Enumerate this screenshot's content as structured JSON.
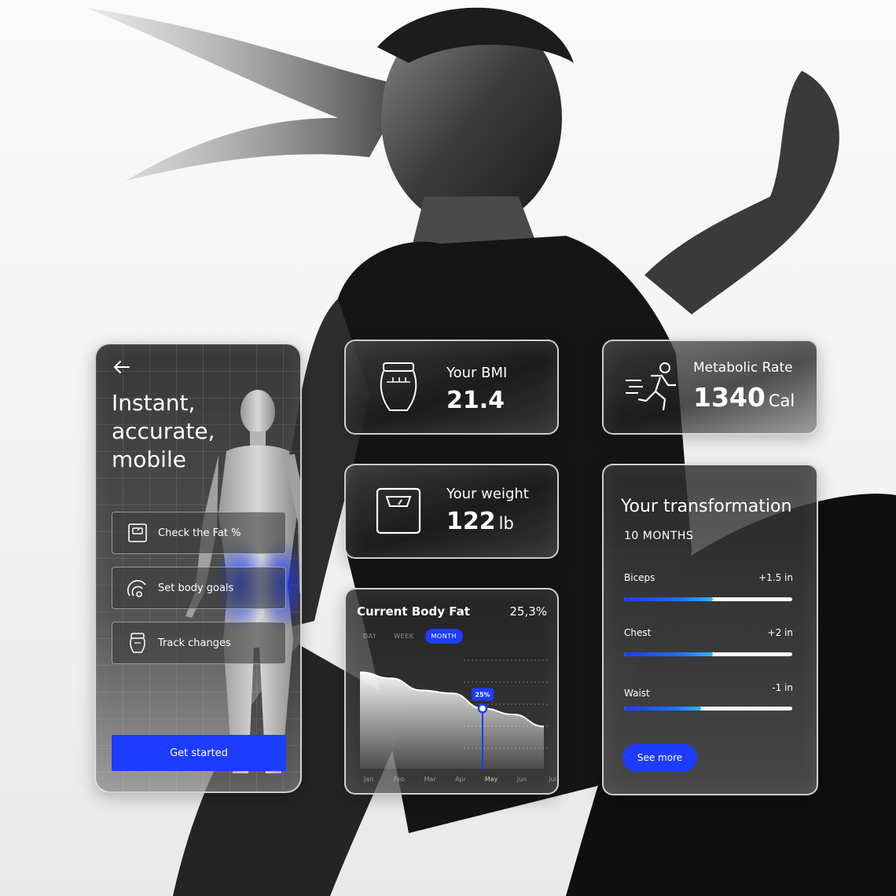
{
  "phone": {
    "back_icon": "arrow-left-icon",
    "title_lines": [
      "Instant,",
      "accurate,",
      "mobile"
    ],
    "options": [
      {
        "label": "Check the Fat %",
        "icon": "scale-icon"
      },
      {
        "label": "Set body goals",
        "icon": "goal-gauge-icon"
      },
      {
        "label": "Track changes",
        "icon": "body-measure-icon"
      }
    ],
    "cta_label": "Get started"
  },
  "bmi": {
    "label": "Your BMI",
    "value": "21.4",
    "icon": "waist-measure-icon"
  },
  "metabolic": {
    "label": "Metabolic Rate",
    "value": "1340",
    "unit": "Cal",
    "icon": "running-person-icon"
  },
  "weight": {
    "label": "Your weight",
    "value": "122",
    "unit": "lb",
    "icon": "weight-scale-icon"
  },
  "body_fat": {
    "title": "Current Body Fat",
    "value": "25,3%",
    "tabs": [
      {
        "label": "DAY",
        "active": false
      },
      {
        "label": "WEEK",
        "active": false
      },
      {
        "label": "MONTH",
        "active": true
      }
    ],
    "marker_label": "25%"
  },
  "chart_data": {
    "type": "area",
    "x": [
      "Jan",
      "Feb",
      "Mar",
      "Apr",
      "May",
      "Jun",
      "Jul"
    ],
    "values": [
      31,
      30,
      28,
      27.5,
      25,
      24,
      22
    ],
    "highlight": {
      "x": "May",
      "label": "25%"
    },
    "grid": true
  },
  "transformation": {
    "title": "Your transformation",
    "subtitle": "10 MONTHS",
    "metrics": [
      {
        "name": "Biceps",
        "change": "+1.5 in",
        "progress": 0.53
      },
      {
        "name": "Chest",
        "change": "+2 in",
        "progress": 0.53
      },
      {
        "name": "Waist",
        "change": "-1 in",
        "progress": 0.46
      }
    ],
    "cta_label": "See more"
  },
  "colors": {
    "accent": "#1e3cff",
    "accent_light": "#2fb4ff"
  }
}
